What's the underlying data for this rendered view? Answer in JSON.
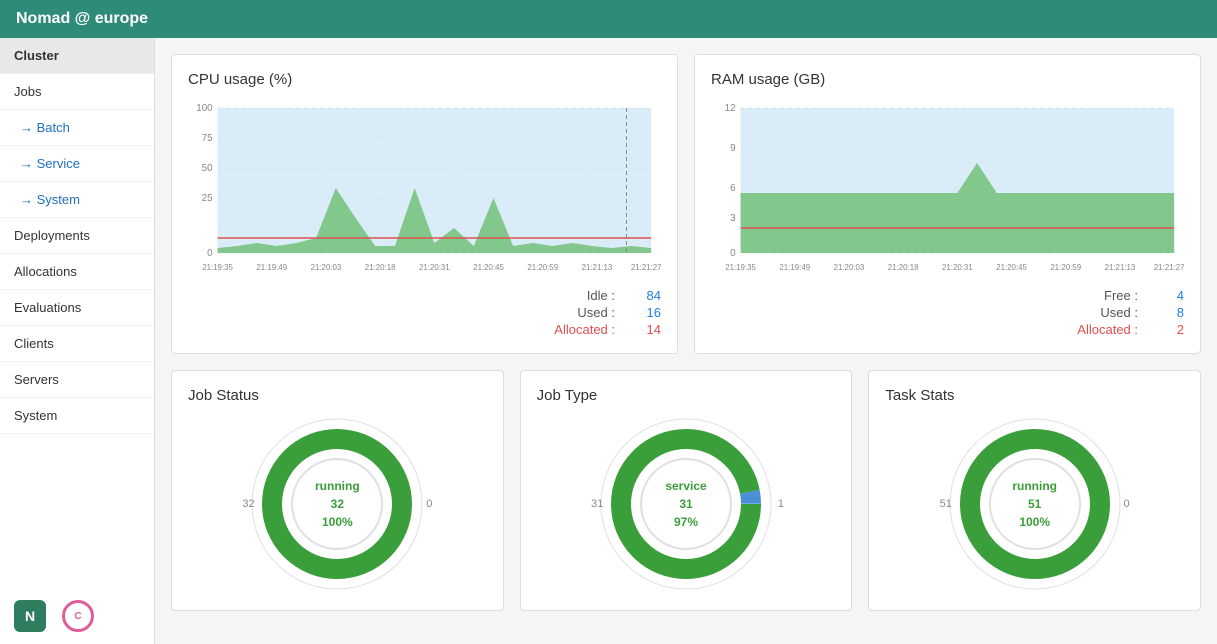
{
  "topbar": {
    "title": "Nomad @ europe"
  },
  "sidebar": {
    "cluster_label": "Cluster",
    "jobs_label": "Jobs",
    "batch_label": "→ Batch",
    "service_label": "→ Service",
    "system_label": "→ System",
    "deployments_label": "Deployments",
    "allocations_label": "Allocations",
    "evaluations_label": "Evaluations",
    "clients_label": "Clients",
    "servers_label": "Servers",
    "system2_label": "System"
  },
  "cpu_chart": {
    "title": "CPU usage (%)",
    "idle_label": "Idle :",
    "idle_value": "84",
    "used_label": "Used :",
    "used_value": "16",
    "allocated_label": "Allocated :",
    "allocated_value": "14",
    "x_labels": [
      "21:19:35",
      "21:19:49",
      "21:20:03",
      "21:20:18",
      "21:20:31",
      "21:20:45",
      "21:20:59",
      "21:21:13",
      "21:21:27"
    ]
  },
  "ram_chart": {
    "title": "RAM usage (GB)",
    "free_label": "Free :",
    "free_value": "4",
    "used_label": "Used :",
    "used_value": "8",
    "allocated_label": "Allocated :",
    "allocated_value": "2",
    "x_labels": [
      "21:19:35",
      "21:19:49",
      "21:20:03",
      "21:20:18",
      "21:20:31",
      "21:20:45",
      "21:20:59",
      "21:21:13",
      "21:21:27"
    ]
  },
  "job_status": {
    "title": "Job Status",
    "center_type": "running",
    "center_count": "32",
    "center_pct": "100%",
    "left_label": "32",
    "right_label": "0"
  },
  "job_type": {
    "title": "Job Type",
    "center_type": "service",
    "center_count": "31",
    "center_pct": "97%",
    "left_label": "31",
    "right_label": "1"
  },
  "task_stats": {
    "title": "Task Stats",
    "center_type": "running",
    "center_count": "51",
    "center_pct": "100%",
    "left_label": "51",
    "right_label": "0"
  },
  "colors": {
    "teal": "#2e8b7a",
    "green": "#3a9e3a",
    "blue": "#2080e0",
    "red": "#e05050",
    "light_green": "#c8e6c9",
    "light_blue": "#cce4f6"
  }
}
